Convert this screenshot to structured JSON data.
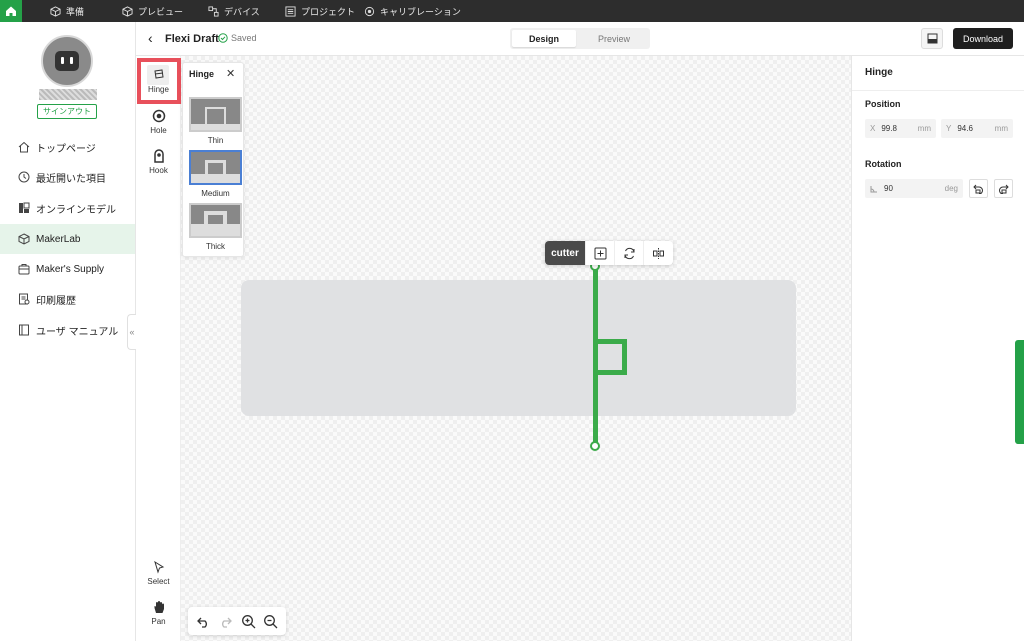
{
  "topnav": {
    "items": [
      {
        "label": "準備",
        "icon": "cube-icon"
      },
      {
        "label": "プレビュー",
        "icon": "cube-outline-icon"
      },
      {
        "label": "デバイス",
        "icon": "devices-icon"
      },
      {
        "label": "プロジェクト",
        "icon": "list-icon"
      },
      {
        "label": "キャリブレーション",
        "icon": "target-icon"
      }
    ]
  },
  "sidebar": {
    "username": "",
    "signout_label": "サインアウト",
    "items": [
      {
        "label": "トップページ",
        "icon": "home-icon"
      },
      {
        "label": "最近開いた項目",
        "icon": "clock-icon"
      },
      {
        "label": "オンラインモデル",
        "icon": "model-icon"
      },
      {
        "label": "MakerLab",
        "icon": "makerlab-icon",
        "active": true
      },
      {
        "label": "Maker's Supply",
        "icon": "supply-icon"
      },
      {
        "label": "印刷履歴",
        "icon": "print-history-icon"
      },
      {
        "label": "ユーザ マニュアル",
        "icon": "manual-icon"
      }
    ],
    "collapse_glyph": "«"
  },
  "header": {
    "back_glyph": "‹",
    "title": "Flexi Draft",
    "saved_label": "Saved",
    "tabs": {
      "design": "Design",
      "preview": "Preview"
    },
    "download_label": "Download"
  },
  "tools": {
    "hinge": "Hinge",
    "hole": "Hole",
    "hook": "Hook",
    "select": "Select",
    "pan": "Pan"
  },
  "hinge_panel": {
    "title": "Hinge",
    "close_glyph": "✕",
    "options": [
      "Thin",
      "Medium",
      "Thick"
    ],
    "selected": "Medium"
  },
  "float_toolbar": {
    "label": "cutter"
  },
  "properties": {
    "title": "Hinge",
    "position_label": "Position",
    "x_label": "X",
    "x_value": "99.8",
    "x_unit": "mm",
    "y_label": "Y",
    "y_value": "94.6",
    "y_unit": "mm",
    "rotation_label": "Rotation",
    "rotation_value": "90",
    "rotation_unit": "deg"
  },
  "colors": {
    "accent": "#24a148",
    "hinge": "#3bab4a",
    "highlight": "#e8505b",
    "topbar": "#2d2d2d"
  }
}
